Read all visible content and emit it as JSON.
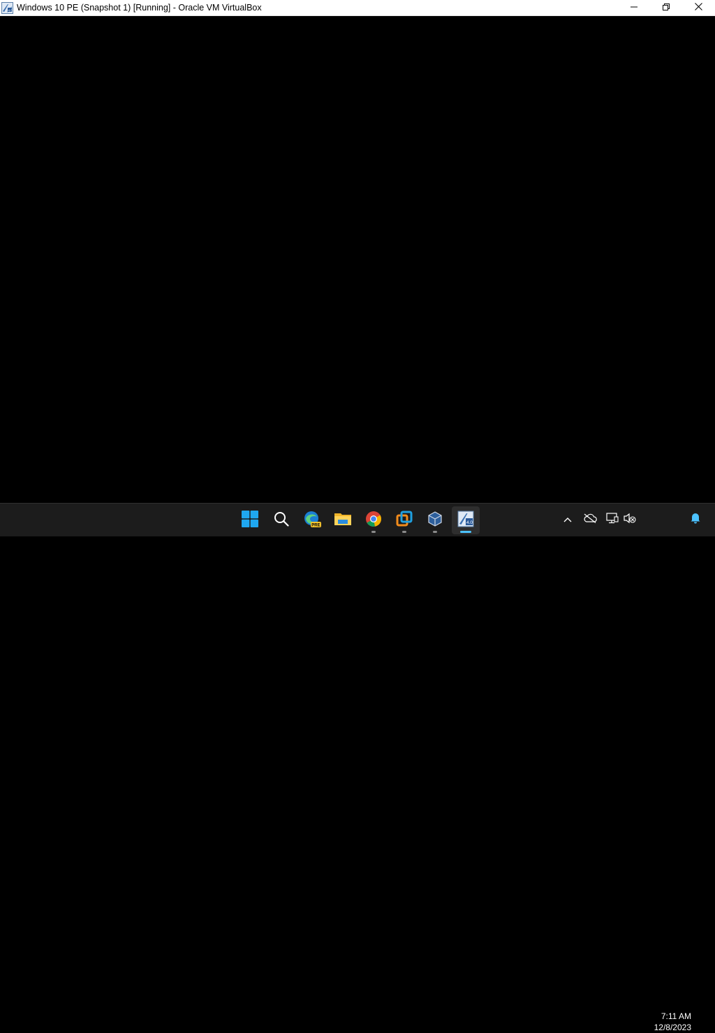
{
  "window": {
    "title": "Windows 10 PE (Snapshot 1) [Running] - Oracle VM VirtualBox",
    "icon": "virtualbox-vm-icon",
    "controls": [
      "minimize-icon",
      "restore-icon",
      "close-icon"
    ]
  },
  "guest_display": {
    "background_color": "#000000"
  },
  "taskbar": {
    "background_color": "#1c1c1c",
    "apps": [
      {
        "name": "start-button",
        "icon": "windows-logo-icon",
        "running": false
      },
      {
        "name": "search-button",
        "icon": "search-icon",
        "running": false
      },
      {
        "name": "edge-preview",
        "icon": "edge-icon",
        "badge": "PRE",
        "running": false
      },
      {
        "name": "file-explorer",
        "icon": "folder-icon",
        "running": false
      },
      {
        "name": "chrome",
        "icon": "chrome-icon",
        "running": true
      },
      {
        "name": "vmware-workstation",
        "icon": "vmware-icon",
        "running": true
      },
      {
        "name": "virtualbox-manager",
        "icon": "virtualbox-cube-icon",
        "running": true
      },
      {
        "name": "virtualbox-vm-window",
        "icon": "virtualbox-vm-icon",
        "running": true,
        "active": true
      }
    ],
    "tray": {
      "icons": [
        "chevron-up-icon",
        "cloud-offline-icon",
        "network-icon",
        "speaker-muted-icon",
        "notification-bell-icon"
      ],
      "time": "7:11 AM",
      "date": "12/8/2023"
    },
    "accent_color": "#4cc2ff"
  }
}
